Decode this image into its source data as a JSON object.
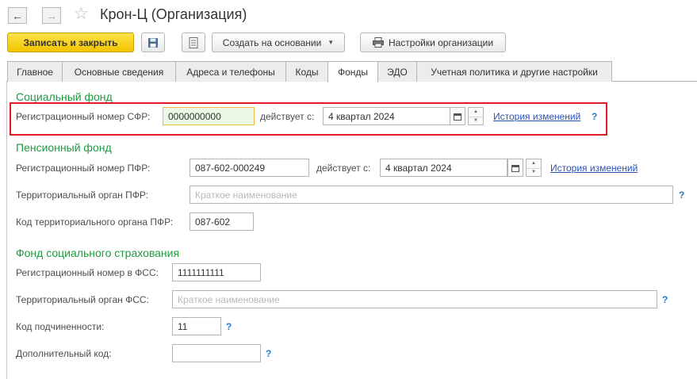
{
  "window": {
    "title": "Крон-Ц (Организация)"
  },
  "nav": {
    "back_icon": "←",
    "forward_icon": "→",
    "favorite_icon": "☆"
  },
  "toolbar": {
    "save_close_label": "Записать и закрыть",
    "create_based_label": "Создать на основании",
    "org_settings_label": "Настройки организации"
  },
  "tabs": [
    {
      "label": "Главное"
    },
    {
      "label": "Основные сведения"
    },
    {
      "label": "Адреса и телефоны"
    },
    {
      "label": "Коды"
    },
    {
      "label": "Фонды",
      "active": true
    },
    {
      "label": "ЭДО"
    },
    {
      "label": "Учетная политика и другие настройки"
    }
  ],
  "sfr": {
    "heading": "Социальный фонд",
    "reg_label": "Регистрационный номер СФР:",
    "reg_value": "0000000000",
    "valid_from_label": "действует с:",
    "valid_from_value": "4 квартал 2024",
    "history_link": "История изменений",
    "help": "?"
  },
  "pfr": {
    "heading": "Пенсионный фонд",
    "reg_label": "Регистрационный номер ПФР:",
    "reg_value": "087-602-000249",
    "valid_from_label": "действует с:",
    "valid_from_value": "4 квартал 2024",
    "history_link": "История изменений",
    "territorial_label": "Территориальный орган ПФР:",
    "territorial_placeholder": "Краткое наименование",
    "territorial_help": "?",
    "territorial_code_label": "Код территориального органа ПФР:",
    "territorial_code_value": "087-602"
  },
  "fss": {
    "heading": "Фонд социального страхования",
    "reg_label": "Регистрационный номер в ФСС:",
    "reg_value": "1111111111",
    "territorial_label": "Территориальный орган ФСС:",
    "territorial_placeholder": "Краткое наименование",
    "territorial_help": "?",
    "subordination_label": "Код подчиненности:",
    "subordination_value": "11",
    "subordination_help": "?",
    "additional_code_label": "Дополнительный код:",
    "additional_code_value": "",
    "additional_code_help": "?"
  },
  "colors": {
    "primary_button": "#f2c400",
    "section_heading": "#1e9a3f",
    "highlight_box": "#e01c24",
    "link": "#2a53b8"
  }
}
